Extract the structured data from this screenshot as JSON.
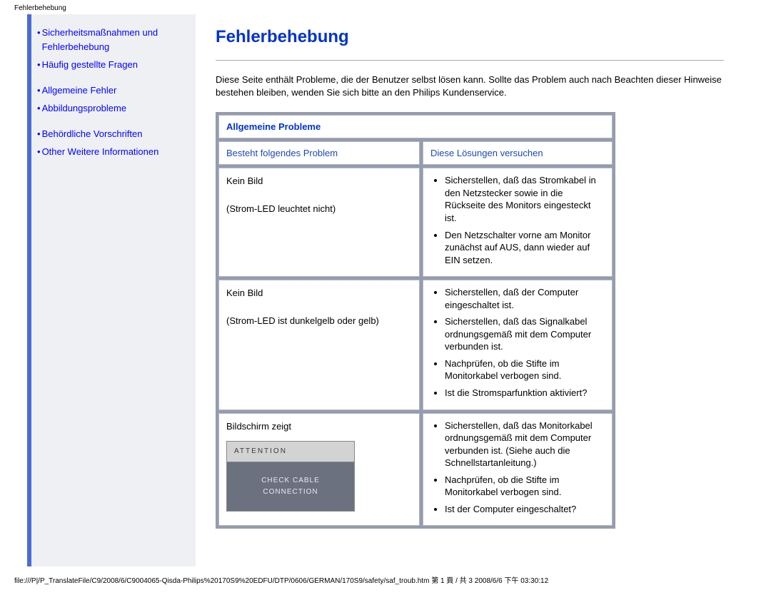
{
  "page_top_title": "Fehlerbehebung",
  "sidebar": {
    "items": [
      {
        "label": "Sicherheitsmaßnahmen und Fehlerbehebung"
      },
      {
        "label": "Häufig gestellte Fragen"
      },
      {
        "label": "Allgemeine Fehler"
      },
      {
        "label": "Abbildungsprobleme"
      },
      {
        "label": "Behördliche Vorschriften"
      },
      {
        "label": "Other Weitere Informationen"
      }
    ]
  },
  "main": {
    "title": "Fehlerbehebung",
    "intro": "Diese Seite enthält Probleme, die der Benutzer selbst lösen kann. Sollte das Problem auch nach Beachten dieser Hinweise bestehen bleiben, wenden Sie sich bitte an den Philips Kundenservice.",
    "section_title": "Allgemeine Probleme",
    "col_problem": "Besteht folgendes Problem",
    "col_solution": "Diese Lösungen versuchen",
    "rows": [
      {
        "problem_line1": "Kein Bild",
        "problem_line2": "(Strom-LED leuchtet nicht)",
        "solutions": [
          "Sicherstellen, daß das Stromkabel in den Netzstecker sowie in die Rückseite des Monitors eingesteckt ist.",
          "Den Netzschalter vorne am Monitor zunächst auf AUS, dann wieder auf EIN setzen."
        ]
      },
      {
        "problem_line1": "Kein Bild",
        "problem_line2": "(Strom-LED ist dunkelgelb oder gelb)",
        "solutions": [
          "Sicherstellen, daß der Computer eingeschaltet ist.",
          "Sicherstellen, daß das Signalkabel ordnungsgemäß mit dem Computer verbunden ist.",
          "Nachprüfen, ob die Stifte im Monitorkabel verbogen sind.",
          "Ist die Stromsparfunktion aktiviert?"
        ]
      },
      {
        "problem_line1": "Bildschirm zeigt",
        "attention_top": "ATTENTION",
        "attention_bot": "CHECK CABLE CONNECTION",
        "solutions": [
          "Sicherstellen, daß das Monitorkabel ordnungsgemäß mit dem Computer verbunden ist. (Siehe auch die Schnellstartanleitung.)",
          "Nachprüfen, ob die Stifte im Monitorkabel verbogen sind.",
          "Ist der Computer eingeschaltet?"
        ]
      }
    ]
  },
  "footer": "file:///P|/P_TranslateFile/C9/2008/6/C9004065-Qisda-Philips%20170S9%20EDFU/DTP/0606/GERMAN/170S9/safety/saf_troub.htm 第 1 頁 / 共 3 2008/6/6 下午 03:30:12"
}
